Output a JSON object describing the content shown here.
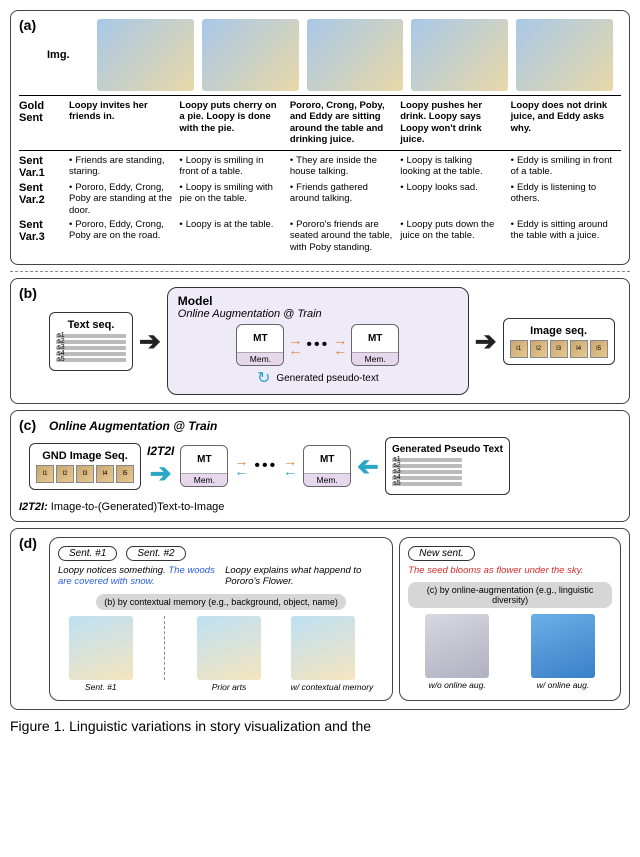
{
  "panelA": {
    "label": "(a)",
    "img_label": "Img.",
    "gold_label": "Gold\nSent",
    "var1_label": "Sent\nVar.1",
    "var2_label": "Sent\nVar.2",
    "var3_label": "Sent\nVar.3",
    "gold": [
      "Loopy invites her friends in.",
      "Loopy puts cherry on a pie. Loopy is done with the pie.",
      "Pororo, Crong, Poby, and Eddy are sitting around the table and drinking juice.",
      "Loopy pushes her drink. Loopy says Loopy won't drink juice.",
      "Loopy does not drink juice, and Eddy asks why."
    ],
    "var1": [
      "Friends are standing, staring.",
      "Loopy is smiling in front of a table.",
      "They are inside the house talking.",
      "Loopy is talking looking at the table.",
      "Eddy is smiling in front of a table."
    ],
    "var2": [
      "Pororo, Eddy, Crong, Poby are standing at the door.",
      "Loopy is smiling with pie on the table.",
      "Friends gathered around talking.",
      "Loopy looks sad.",
      "Eddy is listening to others."
    ],
    "var3": [
      "Pororo, Eddy, Crong, Poby are on the road.",
      "Loopy is at the table.",
      "Pororo's friends are seated around the table, with Poby standing.",
      "Loopy puts down the juice on the table.",
      "Eddy is sitting around the table with a juice."
    ]
  },
  "panelB": {
    "label": "(b)",
    "text_seq_title": "Text seq.",
    "model_title": "Model",
    "model_sub": "Online Augmentation @ Train",
    "mt": "MT",
    "mem": "Mem.",
    "generated": "Generated pseudo-text",
    "image_seq_title": "Image seq.",
    "seq_labels": [
      "I1",
      "I2",
      "I3",
      "I4",
      "I5"
    ],
    "s_labels": [
      "s1",
      "s2",
      "s3",
      "s4",
      "s5"
    ]
  },
  "panelC": {
    "label": "(c)",
    "title": "Online Augmentation @ Train",
    "gnd_title": "GND Image Seq.",
    "i2t2i": "I2T2I",
    "pseudo_title": "Generated Pseudo Text",
    "caption_bold": "I2T2I:",
    "caption_rest": " Image-to-(Generated)Text-to-Image"
  },
  "panelD": {
    "label": "(d)",
    "sent1_tab": "Sent. #1",
    "sent2_tab": "Sent. #2",
    "newsent_tab": "New sent.",
    "sent1_black": "Loopy notices something. ",
    "sent1_blue": "The woods are covered with snow.",
    "sent2": "Loopy explains what happend to Pororo's Flower.",
    "newsent": "The seed blooms as flower under the sky.",
    "pill_b": "(b) by contextual memory (e.g., background, object, name)",
    "pill_c": "(c) by online-augmentation (e.g., linguistic diversity)",
    "caps_left": [
      "Sent. #1",
      "Prior arts",
      "w/ contextual memory"
    ],
    "caps_right": [
      "w/o online aug.",
      "w/ online aug."
    ]
  },
  "figure_caption": "Figure 1. Linguistic variations in story visualization and the"
}
